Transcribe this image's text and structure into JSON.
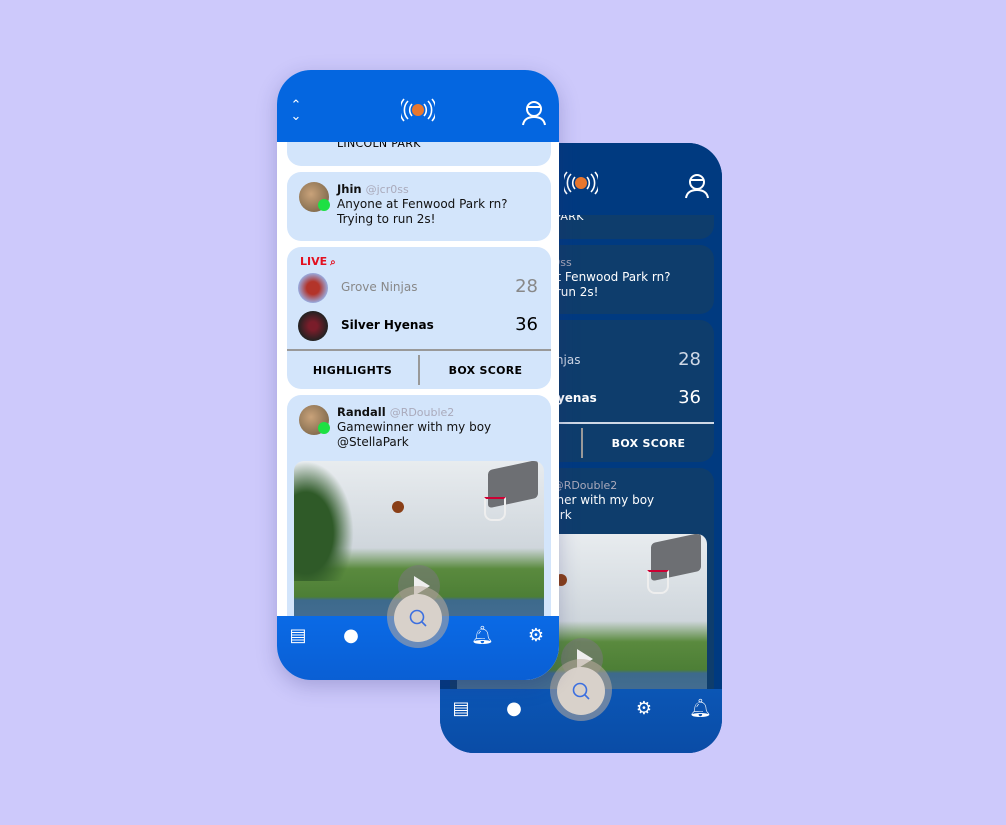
{
  "header": {
    "menu_icon": "chevron-up-down-icon",
    "logo_icon": "basketball-broadcast-logo",
    "profile_icon": "player-avatar-icon"
  },
  "feed": {
    "location_card": {
      "text": "LINCOLN PARK"
    },
    "post1": {
      "name": "Jhin",
      "handle": "@jcr0ss",
      "text": "Anyone at Fenwood Park rn? Trying to run 2s!"
    },
    "live_game": {
      "live_label": "LIVE",
      "teams": [
        {
          "name": "Grove Ninjas",
          "score": "28"
        },
        {
          "name": "Silver Hyenas",
          "score": "36"
        }
      ],
      "highlights": "HIGHLIGHTS",
      "box_score": "BOX SCORE"
    },
    "post2": {
      "name": "Randall",
      "handle": "@RDouble2",
      "text": "Gamewinner with my boy @StellaPark"
    }
  },
  "nav": {
    "items": [
      "hoop-icon",
      "team-icon",
      "search-icon",
      "notifications-icon",
      "settings-icon"
    ]
  },
  "colors": {
    "primary": "#0466e0",
    "dark_primary": "#003a80",
    "card": "#d3e5fb",
    "live": "#e3101f",
    "online": "#1ee043"
  }
}
